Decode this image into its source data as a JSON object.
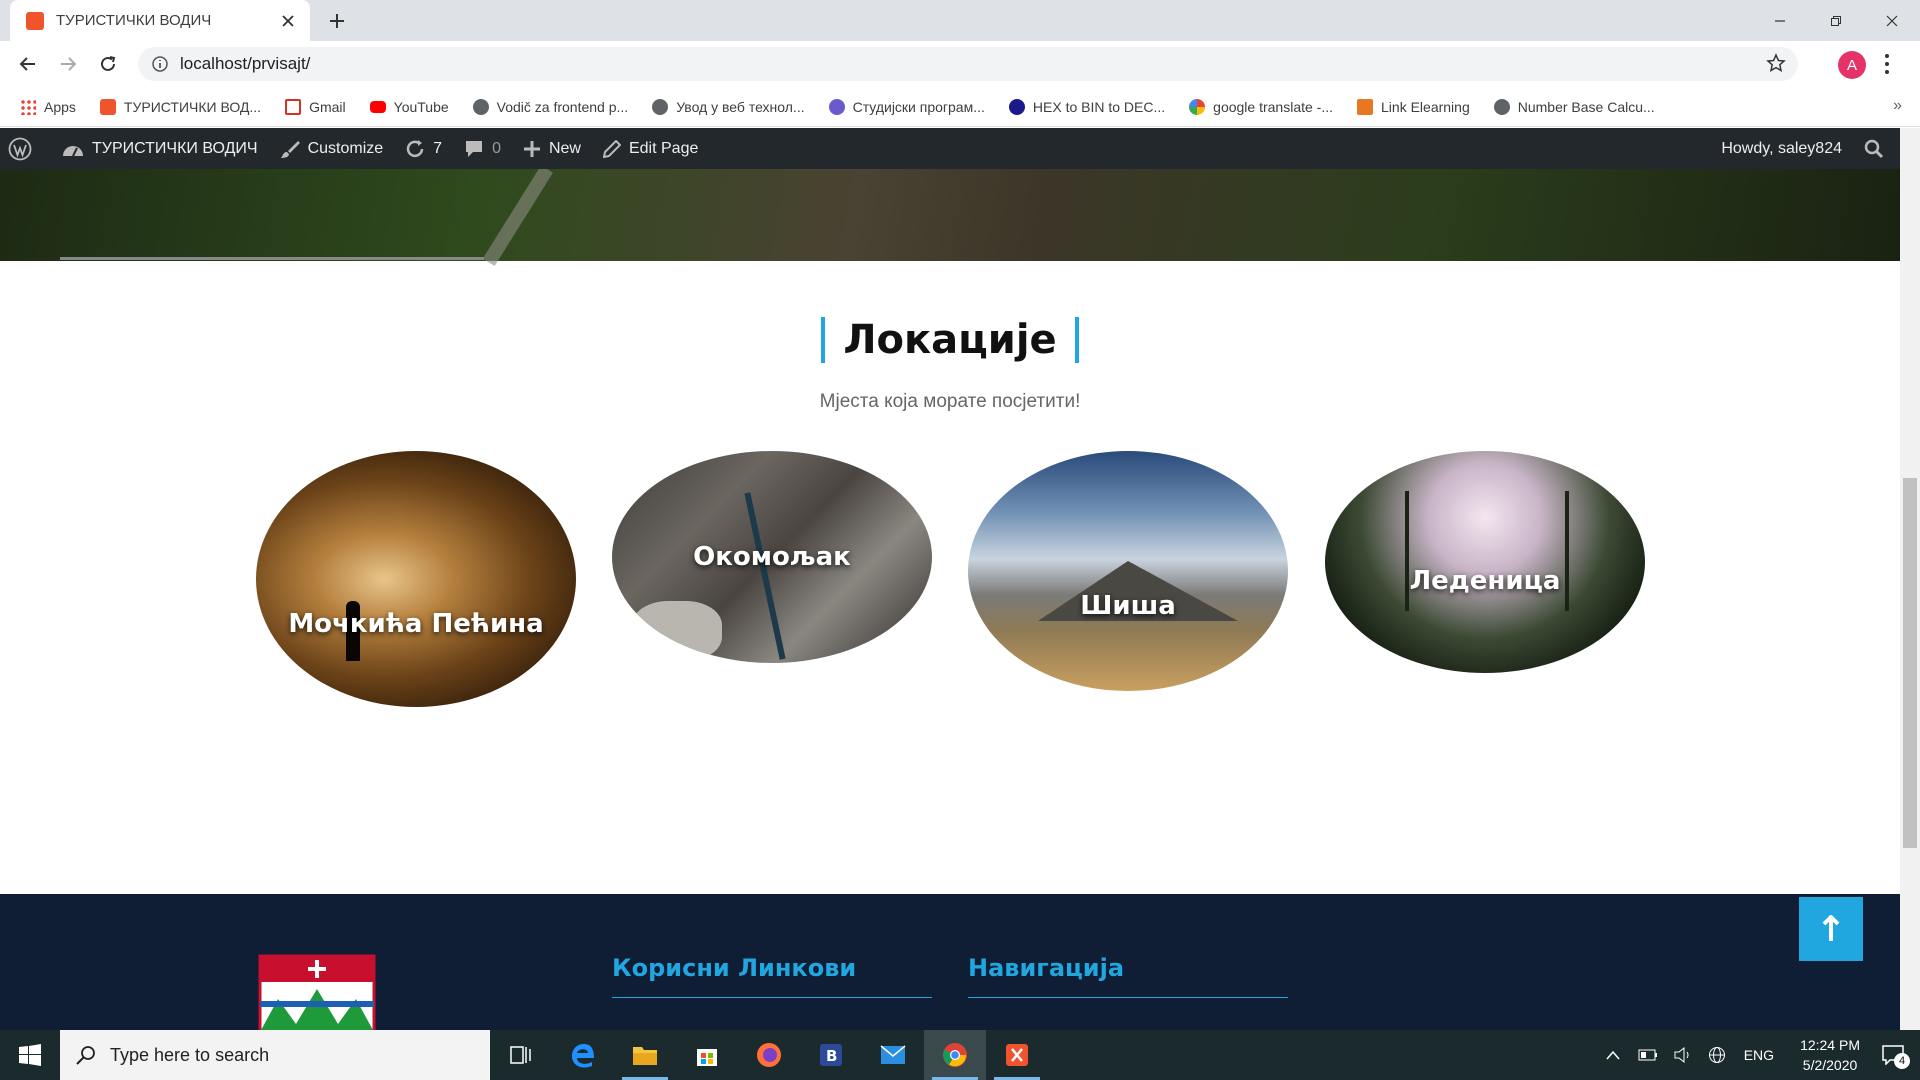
{
  "browser": {
    "tab_title": "ТУРИСТИЧКИ ВОДИЧ",
    "url": "localhost/prvisajt/",
    "profile_initial": "A"
  },
  "bookmarks": [
    {
      "label": "Apps",
      "icon": "apps-grid-icon",
      "color": "#4285f4"
    },
    {
      "label": "ТУРИСТИЧКИ ВОД...",
      "icon": "xampp-icon",
      "color": "#f0542d"
    },
    {
      "label": "Gmail",
      "icon": "gmail-icon",
      "color": "#d93025"
    },
    {
      "label": "YouTube",
      "icon": "youtube-icon",
      "color": "#ff0000"
    },
    {
      "label": "Vodič za frontend p...",
      "icon": "globe-icon",
      "color": "#5f6368"
    },
    {
      "label": "Увод у веб технол...",
      "icon": "globe-icon",
      "color": "#5f6368"
    },
    {
      "label": "Студијски програм...",
      "icon": "university-icon",
      "color": "#6a5acd"
    },
    {
      "label": "HEX to BIN to DEC...",
      "icon": "hex-icon",
      "color": "#1a1a8c"
    },
    {
      "label": "google translate -...",
      "icon": "google-icon",
      "color": "#4285f4"
    },
    {
      "label": "Link Elearning",
      "icon": "link-elearning-icon",
      "color": "#e87722"
    },
    {
      "label": "Number Base Calcu...",
      "icon": "globe-icon",
      "color": "#5f6368"
    }
  ],
  "wp_admin": {
    "site_name": "ТУРИСТИЧКИ ВОДИЧ",
    "customize": "Customize",
    "updates": "7",
    "comments": "0",
    "new": "New",
    "edit_page": "Edit Page",
    "howdy": "Howdy, saley824"
  },
  "locations": {
    "title": "Локације",
    "subtitle": "Мјеста која морате посјетити!",
    "items": [
      {
        "name": "Мочкића Пећина",
        "photo": "cave-photo"
      },
      {
        "name": "Окомољак",
        "photo": "canyon-photo"
      },
      {
        "name": "Шиша",
        "photo": "mountain-photo"
      },
      {
        "name": "Леденица",
        "photo": "forest-cave-photo"
      }
    ]
  },
  "footer": {
    "col1_title": "Корисни Линкови",
    "col2_title": "Навигација"
  },
  "taskbar": {
    "search_placeholder": "Type here to search",
    "lang": "ENG",
    "time": "12:24 PM",
    "date": "5/2/2020",
    "notifications": "4"
  },
  "colors": {
    "accent": "#21a7e0",
    "footer_bg": "#0f1e35",
    "wpbar_bg": "#23282d"
  }
}
